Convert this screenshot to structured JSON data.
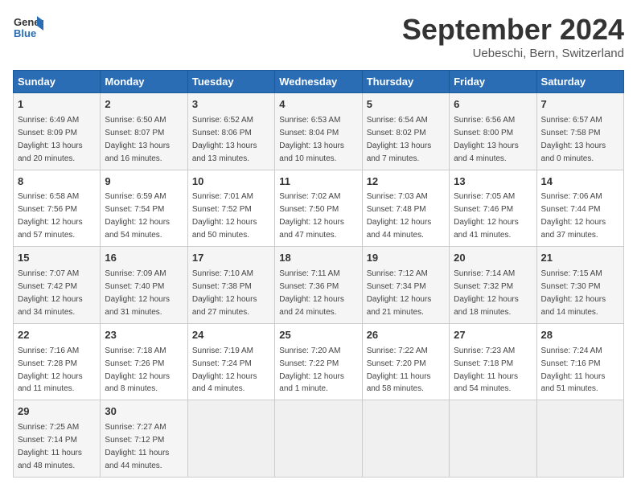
{
  "logo": {
    "text_general": "General",
    "text_blue": "Blue"
  },
  "title": "September 2024",
  "location": "Uebeschi, Bern, Switzerland",
  "days_of_week": [
    "Sunday",
    "Monday",
    "Tuesday",
    "Wednesday",
    "Thursday",
    "Friday",
    "Saturday"
  ],
  "weeks": [
    [
      {
        "day": "1",
        "rise": "Sunrise: 6:49 AM",
        "set": "Sunset: 8:09 PM",
        "daylight": "Daylight: 13 hours and 20 minutes."
      },
      {
        "day": "2",
        "rise": "Sunrise: 6:50 AM",
        "set": "Sunset: 8:07 PM",
        "daylight": "Daylight: 13 hours and 16 minutes."
      },
      {
        "day": "3",
        "rise": "Sunrise: 6:52 AM",
        "set": "Sunset: 8:06 PM",
        "daylight": "Daylight: 13 hours and 13 minutes."
      },
      {
        "day": "4",
        "rise": "Sunrise: 6:53 AM",
        "set": "Sunset: 8:04 PM",
        "daylight": "Daylight: 13 hours and 10 minutes."
      },
      {
        "day": "5",
        "rise": "Sunrise: 6:54 AM",
        "set": "Sunset: 8:02 PM",
        "daylight": "Daylight: 13 hours and 7 minutes."
      },
      {
        "day": "6",
        "rise": "Sunrise: 6:56 AM",
        "set": "Sunset: 8:00 PM",
        "daylight": "Daylight: 13 hours and 4 minutes."
      },
      {
        "day": "7",
        "rise": "Sunrise: 6:57 AM",
        "set": "Sunset: 7:58 PM",
        "daylight": "Daylight: 13 hours and 0 minutes."
      }
    ],
    [
      {
        "day": "8",
        "rise": "Sunrise: 6:58 AM",
        "set": "Sunset: 7:56 PM",
        "daylight": "Daylight: 12 hours and 57 minutes."
      },
      {
        "day": "9",
        "rise": "Sunrise: 6:59 AM",
        "set": "Sunset: 7:54 PM",
        "daylight": "Daylight: 12 hours and 54 minutes."
      },
      {
        "day": "10",
        "rise": "Sunrise: 7:01 AM",
        "set": "Sunset: 7:52 PM",
        "daylight": "Daylight: 12 hours and 50 minutes."
      },
      {
        "day": "11",
        "rise": "Sunrise: 7:02 AM",
        "set": "Sunset: 7:50 PM",
        "daylight": "Daylight: 12 hours and 47 minutes."
      },
      {
        "day": "12",
        "rise": "Sunrise: 7:03 AM",
        "set": "Sunset: 7:48 PM",
        "daylight": "Daylight: 12 hours and 44 minutes."
      },
      {
        "day": "13",
        "rise": "Sunrise: 7:05 AM",
        "set": "Sunset: 7:46 PM",
        "daylight": "Daylight: 12 hours and 41 minutes."
      },
      {
        "day": "14",
        "rise": "Sunrise: 7:06 AM",
        "set": "Sunset: 7:44 PM",
        "daylight": "Daylight: 12 hours and 37 minutes."
      }
    ],
    [
      {
        "day": "15",
        "rise": "Sunrise: 7:07 AM",
        "set": "Sunset: 7:42 PM",
        "daylight": "Daylight: 12 hours and 34 minutes."
      },
      {
        "day": "16",
        "rise": "Sunrise: 7:09 AM",
        "set": "Sunset: 7:40 PM",
        "daylight": "Daylight: 12 hours and 31 minutes."
      },
      {
        "day": "17",
        "rise": "Sunrise: 7:10 AM",
        "set": "Sunset: 7:38 PM",
        "daylight": "Daylight: 12 hours and 27 minutes."
      },
      {
        "day": "18",
        "rise": "Sunrise: 7:11 AM",
        "set": "Sunset: 7:36 PM",
        "daylight": "Daylight: 12 hours and 24 minutes."
      },
      {
        "day": "19",
        "rise": "Sunrise: 7:12 AM",
        "set": "Sunset: 7:34 PM",
        "daylight": "Daylight: 12 hours and 21 minutes."
      },
      {
        "day": "20",
        "rise": "Sunrise: 7:14 AM",
        "set": "Sunset: 7:32 PM",
        "daylight": "Daylight: 12 hours and 18 minutes."
      },
      {
        "day": "21",
        "rise": "Sunrise: 7:15 AM",
        "set": "Sunset: 7:30 PM",
        "daylight": "Daylight: 12 hours and 14 minutes."
      }
    ],
    [
      {
        "day": "22",
        "rise": "Sunrise: 7:16 AM",
        "set": "Sunset: 7:28 PM",
        "daylight": "Daylight: 12 hours and 11 minutes."
      },
      {
        "day": "23",
        "rise": "Sunrise: 7:18 AM",
        "set": "Sunset: 7:26 PM",
        "daylight": "Daylight: 12 hours and 8 minutes."
      },
      {
        "day": "24",
        "rise": "Sunrise: 7:19 AM",
        "set": "Sunset: 7:24 PM",
        "daylight": "Daylight: 12 hours and 4 minutes."
      },
      {
        "day": "25",
        "rise": "Sunrise: 7:20 AM",
        "set": "Sunset: 7:22 PM",
        "daylight": "Daylight: 12 hours and 1 minute."
      },
      {
        "day": "26",
        "rise": "Sunrise: 7:22 AM",
        "set": "Sunset: 7:20 PM",
        "daylight": "Daylight: 11 hours and 58 minutes."
      },
      {
        "day": "27",
        "rise": "Sunrise: 7:23 AM",
        "set": "Sunset: 7:18 PM",
        "daylight": "Daylight: 11 hours and 54 minutes."
      },
      {
        "day": "28",
        "rise": "Sunrise: 7:24 AM",
        "set": "Sunset: 7:16 PM",
        "daylight": "Daylight: 11 hours and 51 minutes."
      }
    ],
    [
      {
        "day": "29",
        "rise": "Sunrise: 7:25 AM",
        "set": "Sunset: 7:14 PM",
        "daylight": "Daylight: 11 hours and 48 minutes."
      },
      {
        "day": "30",
        "rise": "Sunrise: 7:27 AM",
        "set": "Sunset: 7:12 PM",
        "daylight": "Daylight: 11 hours and 44 minutes."
      },
      null,
      null,
      null,
      null,
      null
    ]
  ]
}
